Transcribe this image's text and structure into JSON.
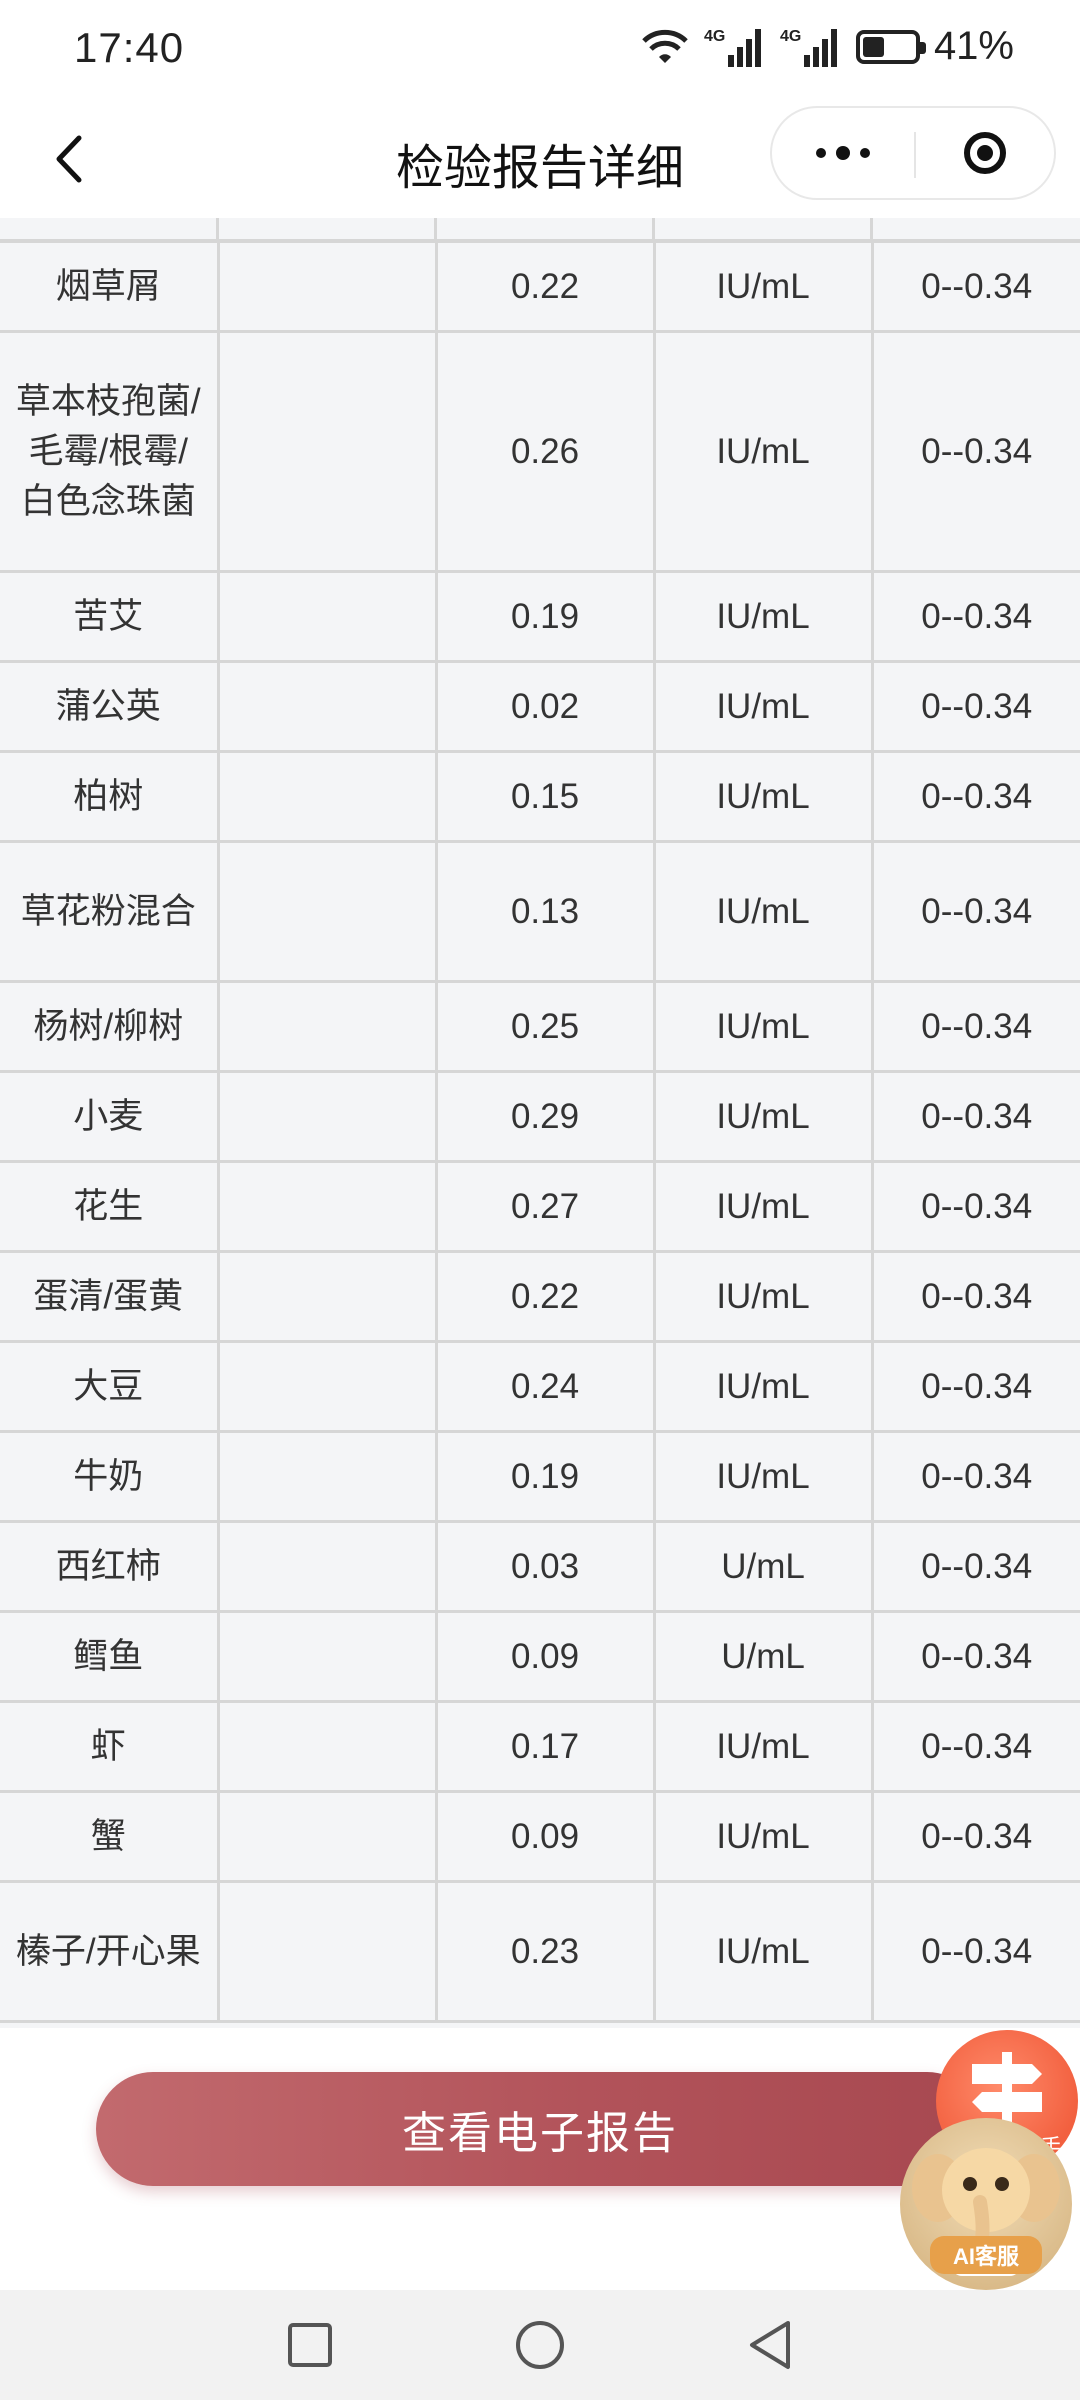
{
  "status_bar": {
    "time": "17:40",
    "battery_percent": "41%",
    "battery_level": 0.41
  },
  "nav": {
    "title": "检验报告详细"
  },
  "table": {
    "rows": [
      {
        "name": "烟草屑",
        "value": "0.22",
        "unit": "IU/mL",
        "range": "0--0.34"
      },
      {
        "name": "草本枝孢菌/毛霉/根霉/白色念珠菌",
        "value": "0.26",
        "unit": "IU/mL",
        "range": "0--0.34"
      },
      {
        "name": "苦艾",
        "value": "0.19",
        "unit": "IU/mL",
        "range": "0--0.34"
      },
      {
        "name": "蒲公英",
        "value": "0.02",
        "unit": "IU/mL",
        "range": "0--0.34"
      },
      {
        "name": "柏树",
        "value": "0.15",
        "unit": "IU/mL",
        "range": "0--0.34"
      },
      {
        "name": "草花粉混合",
        "value": "0.13",
        "unit": "IU/mL",
        "range": "0--0.34"
      },
      {
        "name": "杨树/柳树",
        "value": "0.25",
        "unit": "IU/mL",
        "range": "0--0.34"
      },
      {
        "name": "小麦",
        "value": "0.29",
        "unit": "IU/mL",
        "range": "0--0.34"
      },
      {
        "name": "花生",
        "value": "0.27",
        "unit": "IU/mL",
        "range": "0--0.34"
      },
      {
        "name": "蛋清/蛋黄",
        "value": "0.22",
        "unit": "IU/mL",
        "range": "0--0.34"
      },
      {
        "name": "大豆",
        "value": "0.24",
        "unit": "IU/mL",
        "range": "0--0.34"
      },
      {
        "name": "牛奶",
        "value": "0.19",
        "unit": "IU/mL",
        "range": "0--0.34"
      },
      {
        "name": "西红柿",
        "value": "0.03",
        "unit": "U/mL",
        "range": "0--0.34"
      },
      {
        "name": "鳕鱼",
        "value": "0.09",
        "unit": "U/mL",
        "range": "0--0.34"
      },
      {
        "name": "虾",
        "value": "0.17",
        "unit": "IU/mL",
        "range": "0--0.34"
      },
      {
        "name": "蟹",
        "value": "0.09",
        "unit": "IU/mL",
        "range": "0--0.34"
      },
      {
        "name": "榛子/开心果",
        "value": "0.23",
        "unit": "IU/mL",
        "range": "0--0.34"
      }
    ]
  },
  "actions": {
    "view_report": "查看电子报告"
  },
  "floating": {
    "assistant_tag": "手",
    "ai_service": "AI客服"
  },
  "icons": {
    "back": "chevron-left-icon",
    "more": "more-dots-icon",
    "close": "target-close-icon",
    "nav_square": "square-recents-icon",
    "nav_home": "circle-home-icon",
    "nav_back": "triangle-back-icon"
  },
  "colors": {
    "button_start": "#c26a6e",
    "button_end": "#a74850",
    "assistant": "#f2603f"
  }
}
